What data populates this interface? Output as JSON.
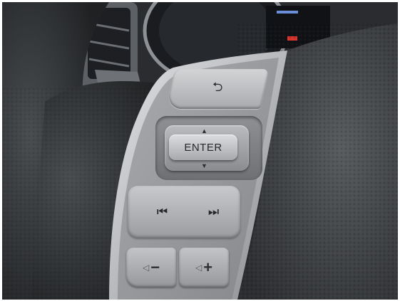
{
  "buttons": {
    "back_icon": "⮌",
    "enter_label": "ENTER",
    "up_arrow": "▲",
    "down_arrow": "▼",
    "prev_icon": "⏮",
    "next_icon": "⏭",
    "volume_down_icon": "◁",
    "volume_down_sign": "−",
    "volume_up_icon": "◁",
    "volume_up_sign": "+"
  },
  "colors": {
    "leather": "#3a3d40",
    "trim_silver": "#c9cacc",
    "button_face": "#b9bbbe",
    "dash_dark": "#1c1e21"
  }
}
